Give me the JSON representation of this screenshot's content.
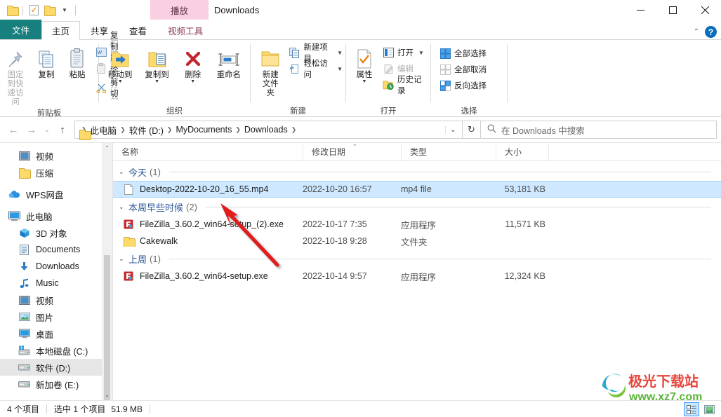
{
  "window": {
    "title": "Downloads",
    "contextual_tab_header": "播放",
    "controls": {
      "minimize": "—",
      "maximize": "▫",
      "close": "✕"
    },
    "ribbon_collapse": "⌃",
    "help": "?"
  },
  "quick_access": [
    {
      "name": "folder-icon",
      "label": "属性"
    },
    {
      "name": "properties-icon",
      "label": "属性"
    },
    {
      "name": "new-folder-icon",
      "label": "新建文件夹"
    },
    {
      "name": "customize-caret",
      "label": "▾"
    }
  ],
  "tabs": [
    {
      "id": "file",
      "label": "文件",
      "active": false,
      "kind": "file"
    },
    {
      "id": "home",
      "label": "主页",
      "active": true,
      "kind": "normal"
    },
    {
      "id": "share",
      "label": "共享",
      "active": false,
      "kind": "normal"
    },
    {
      "id": "view",
      "label": "查看",
      "active": false,
      "kind": "normal"
    },
    {
      "id": "videotools",
      "label": "视频工具",
      "active": false,
      "kind": "contextual"
    }
  ],
  "ribbon": {
    "groups": [
      {
        "title": "剪贴板",
        "big_buttons": [
          {
            "name": "pin-to-quick-access",
            "label": "固定到快\n速访问",
            "icon": "pin-icon",
            "dim": true
          },
          {
            "name": "copy",
            "label": "复制",
            "icon": "copy-icon"
          },
          {
            "name": "paste",
            "label": "粘贴",
            "icon": "paste-icon"
          }
        ],
        "small_buttons": [
          {
            "name": "copy-path",
            "label": "复制路径",
            "icon": "copy-path-icon"
          },
          {
            "name": "paste-shortcut",
            "label": "粘贴快捷方式",
            "icon": "paste-shortcut-icon",
            "dim": true
          },
          {
            "name": "cut",
            "label": "剪切",
            "icon": "scissors-icon"
          }
        ]
      },
      {
        "title": "组织",
        "big_buttons": [
          {
            "name": "move-to",
            "label": "移动到",
            "icon": "move-to-icon",
            "caret": true
          },
          {
            "name": "copy-to",
            "label": "复制到",
            "icon": "copy-to-icon",
            "caret": true
          },
          {
            "name": "delete",
            "label": "删除",
            "icon": "delete-icon",
            "caret": true
          },
          {
            "name": "rename",
            "label": "重命名",
            "icon": "rename-icon"
          }
        ],
        "small_buttons": []
      },
      {
        "title": "新建",
        "big_buttons": [
          {
            "name": "new-folder",
            "label": "新建\n文件夹",
            "icon": "new-folder-icon"
          }
        ],
        "small_buttons": [
          {
            "name": "new-item",
            "label": "新建项目",
            "icon": "new-item-icon",
            "caret": true
          },
          {
            "name": "easy-access",
            "label": "轻松访问",
            "icon": "easy-access-icon",
            "caret": true
          }
        ]
      },
      {
        "title": "打开",
        "big_buttons": [
          {
            "name": "properties",
            "label": "属性",
            "icon": "properties-icon",
            "caret": true
          }
        ],
        "small_buttons": [
          {
            "name": "open",
            "label": "打开",
            "icon": "open-icon",
            "caret": true
          },
          {
            "name": "edit",
            "label": "编辑",
            "icon": "edit-icon",
            "dim": true
          },
          {
            "name": "history",
            "label": "历史记录",
            "icon": "history-icon"
          }
        ]
      },
      {
        "title": "选择",
        "big_buttons": [],
        "small_buttons": [
          {
            "name": "select-all",
            "label": "全部选择",
            "icon": "select-all-icon"
          },
          {
            "name": "select-none",
            "label": "全部取消",
            "icon": "select-none-icon"
          },
          {
            "name": "invert-selection",
            "label": "反向选择",
            "icon": "invert-selection-icon"
          }
        ]
      }
    ]
  },
  "address": {
    "back": "←",
    "forward": "→",
    "recent": "⌄",
    "up": "↑",
    "crumbs": [
      "此电脑",
      "软件 (D:)",
      "MyDocuments",
      "Downloads"
    ],
    "dropdown_caret": "⌄",
    "refresh": "↻",
    "search_placeholder": "在 Downloads 中搜索",
    "search_value": ""
  },
  "nav_pane": {
    "items": [
      {
        "label": "视频",
        "icon": "video-folder-icon",
        "indent": 1,
        "selected": false
      },
      {
        "label": "压缩",
        "icon": "folder-icon",
        "indent": 1,
        "selected": false
      },
      {
        "label": "WPS网盘",
        "icon": "cloud-icon",
        "indent": 0,
        "selected": false,
        "gap_before": true
      },
      {
        "label": "此电脑",
        "icon": "this-pc-icon",
        "indent": 0,
        "selected": false,
        "gap_before": true
      },
      {
        "label": "3D 对象",
        "icon": "3d-objects-icon",
        "indent": 1,
        "selected": false
      },
      {
        "label": "Documents",
        "icon": "documents-icon",
        "indent": 1,
        "selected": false
      },
      {
        "label": "Downloads",
        "icon": "downloads-icon",
        "indent": 1,
        "selected": false
      },
      {
        "label": "Music",
        "icon": "music-icon",
        "indent": 1,
        "selected": false
      },
      {
        "label": "视频",
        "icon": "video-folder-icon",
        "indent": 1,
        "selected": false
      },
      {
        "label": "图片",
        "icon": "pictures-icon",
        "indent": 1,
        "selected": false
      },
      {
        "label": "桌面",
        "icon": "desktop-icon",
        "indent": 1,
        "selected": false
      },
      {
        "label": "本地磁盘 (C:)",
        "icon": "windows-drive-icon",
        "indent": 1,
        "selected": false
      },
      {
        "label": "软件 (D:)",
        "icon": "drive-icon",
        "indent": 1,
        "selected": true
      },
      {
        "label": "新加卷 (E:)",
        "icon": "drive-icon",
        "indent": 1,
        "selected": false
      }
    ],
    "scroll_up": "⌃",
    "scroll_down": "⌄"
  },
  "columns": [
    {
      "key": "name",
      "label": "名称",
      "sorted": false
    },
    {
      "key": "date",
      "label": "修改日期",
      "sorted": true,
      "sort_dir": "⌄"
    },
    {
      "key": "type",
      "label": "类型",
      "sorted": false
    },
    {
      "key": "size",
      "label": "大小",
      "sorted": false
    }
  ],
  "groups": [
    {
      "caret": "⌄",
      "label": "今天",
      "count": "(1)",
      "rows": [
        {
          "icon": "generic-file-icon",
          "name": "Desktop-2022-10-20_16_55.mp4",
          "date": "2022-10-20 16:57",
          "type": "mp4 file",
          "size": "53,181 KB",
          "selected": true
        }
      ]
    },
    {
      "caret": "⌄",
      "label": "本周早些时候",
      "count": "(2)",
      "rows": [
        {
          "icon": "filezilla-icon",
          "name": "FileZilla_3.60.2_win64-setup_(2).exe",
          "date": "2022-10-17 7:35",
          "type": "应用程序",
          "size": "11,571 KB",
          "selected": false
        },
        {
          "icon": "folder-icon",
          "name": "Cakewalk",
          "date": "2022-10-18 9:28",
          "type": "文件夹",
          "size": "",
          "selected": false
        }
      ]
    },
    {
      "caret": "⌄",
      "label": "上周",
      "count": "(1)",
      "rows": [
        {
          "icon": "filezilla-icon",
          "name": "FileZilla_3.60.2_win64-setup.exe",
          "date": "2022-10-14 9:57",
          "type": "应用程序",
          "size": "12,324 KB",
          "selected": false
        }
      ]
    }
  ],
  "status": {
    "item_count": "4 个项目",
    "selection": "选中 1 个项目",
    "selection_size": "51.9 MB",
    "view_details": "详细信息",
    "view_large_icons": "大图标"
  },
  "watermark": {
    "title": "极光下载站",
    "url": "www.xz7.com"
  },
  "colors": {
    "file_tab": "#17807e",
    "contextual": "#f9cfe1",
    "selection": "#cde8ff",
    "group_header": "#2b5797",
    "annotation_arrow": "#e01b1b"
  }
}
